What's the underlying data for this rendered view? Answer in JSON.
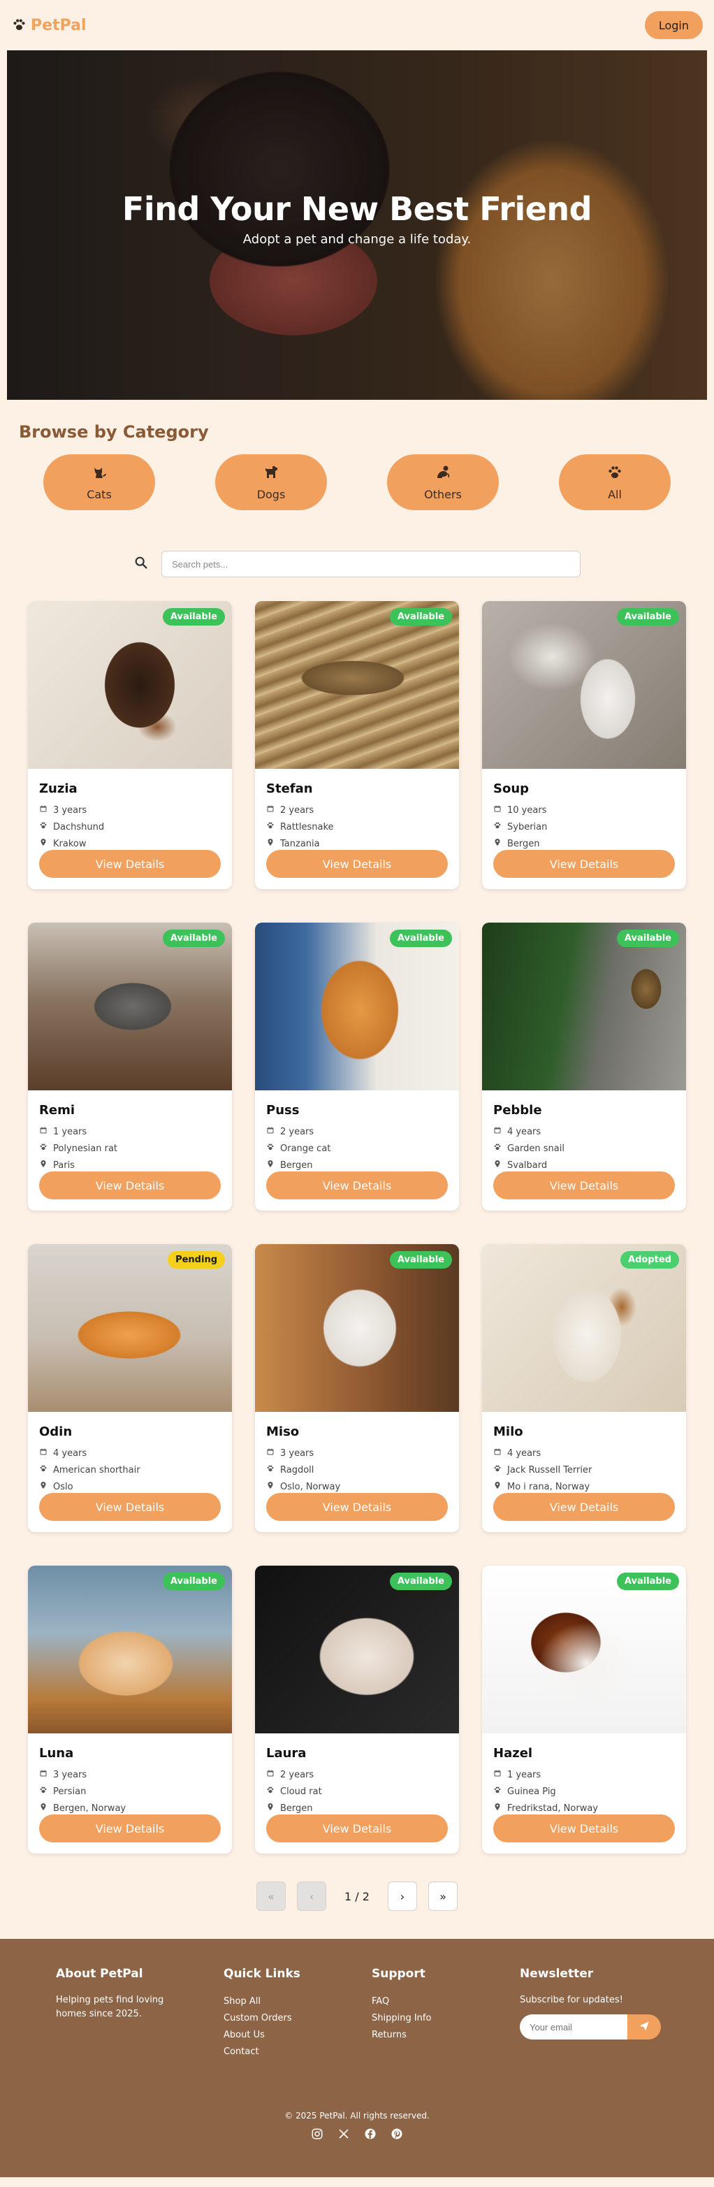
{
  "brand": {
    "name": "PetPal"
  },
  "nav": {
    "login_label": "Login"
  },
  "hero": {
    "title": "Find Your New Best Friend",
    "subtitle": "Adopt a pet and change a life today."
  },
  "categories": {
    "heading": "Browse by Category",
    "items": [
      {
        "label": "Cats",
        "icon": "cat-icon"
      },
      {
        "label": "Dogs",
        "icon": "dog-icon"
      },
      {
        "label": "Others",
        "icon": "critter-icon"
      },
      {
        "label": "All",
        "icon": "paw-icon"
      }
    ]
  },
  "search": {
    "placeholder": "Search pets..."
  },
  "pets": [
    {
      "name": "Zuzia",
      "age": "3 years",
      "breed": "Dachshund",
      "location": "Krakow",
      "status": "Available",
      "button": "View Details"
    },
    {
      "name": "Stefan",
      "age": "2 years",
      "breed": "Rattlesnake",
      "location": "Tanzania",
      "status": "Available",
      "button": "View Details"
    },
    {
      "name": "Soup",
      "age": "10 years",
      "breed": "Syberian",
      "location": "Bergen",
      "status": "Available",
      "button": "View Details"
    },
    {
      "name": "Remi",
      "age": "1 years",
      "breed": "Polynesian rat",
      "location": "Paris",
      "status": "Available",
      "button": "View Details"
    },
    {
      "name": "Puss",
      "age": "2 years",
      "breed": "Orange cat",
      "location": "Bergen",
      "status": "Available",
      "button": "View Details"
    },
    {
      "name": "Pebble",
      "age": "4 years",
      "breed": "Garden snail",
      "location": "Svalbard",
      "status": "Available",
      "button": "View Details"
    },
    {
      "name": "Odin",
      "age": "4 years",
      "breed": "American shorthair",
      "location": "Oslo",
      "status": "Pending",
      "button": "View Details"
    },
    {
      "name": "Miso",
      "age": "3 years",
      "breed": "Ragdoll",
      "location": "Oslo, Norway",
      "status": "Available",
      "button": "View Details"
    },
    {
      "name": "Milo",
      "age": "4 years",
      "breed": "Jack Russell Terrier",
      "location": "Mo i rana, Norway",
      "status": "Adopted",
      "button": "View Details"
    },
    {
      "name": "Luna",
      "age": "3 years",
      "breed": "Persian",
      "location": "Bergen, Norway",
      "status": "Available",
      "button": "View Details"
    },
    {
      "name": "Laura",
      "age": "2 years",
      "breed": "Cloud rat",
      "location": "Bergen",
      "status": "Available",
      "button": "View Details"
    },
    {
      "name": "Hazel",
      "age": "1 years",
      "breed": "Guinea Pig",
      "location": "Fredrikstad, Norway",
      "status": "Available",
      "button": "View Details"
    }
  ],
  "pagination": {
    "first": "«",
    "prev": "‹",
    "info": "1 / 2",
    "next": "›",
    "last": "»"
  },
  "footer": {
    "about_title": "About PetPal",
    "about_text": "Helping pets find loving homes since 2025.",
    "quick_title": "Quick Links",
    "quick_links": [
      "Shop All",
      "Custom Orders",
      "About Us",
      "Contact"
    ],
    "support_title": "Support",
    "support_links": [
      "FAQ",
      "Shipping Info",
      "Returns"
    ],
    "newsletter_title": "Newsletter",
    "newsletter_text": "Subscribe for updates!",
    "email_placeholder": "Your email",
    "copyright": "© 2025 PetPal. All rights reserved."
  },
  "colors": {
    "accent": "#f2a05e",
    "available": "#3cc258",
    "pending": "#f4cf1c",
    "adopted": "#4bcf6f",
    "footer": "#8d6445",
    "background": "#fdf1e6"
  }
}
